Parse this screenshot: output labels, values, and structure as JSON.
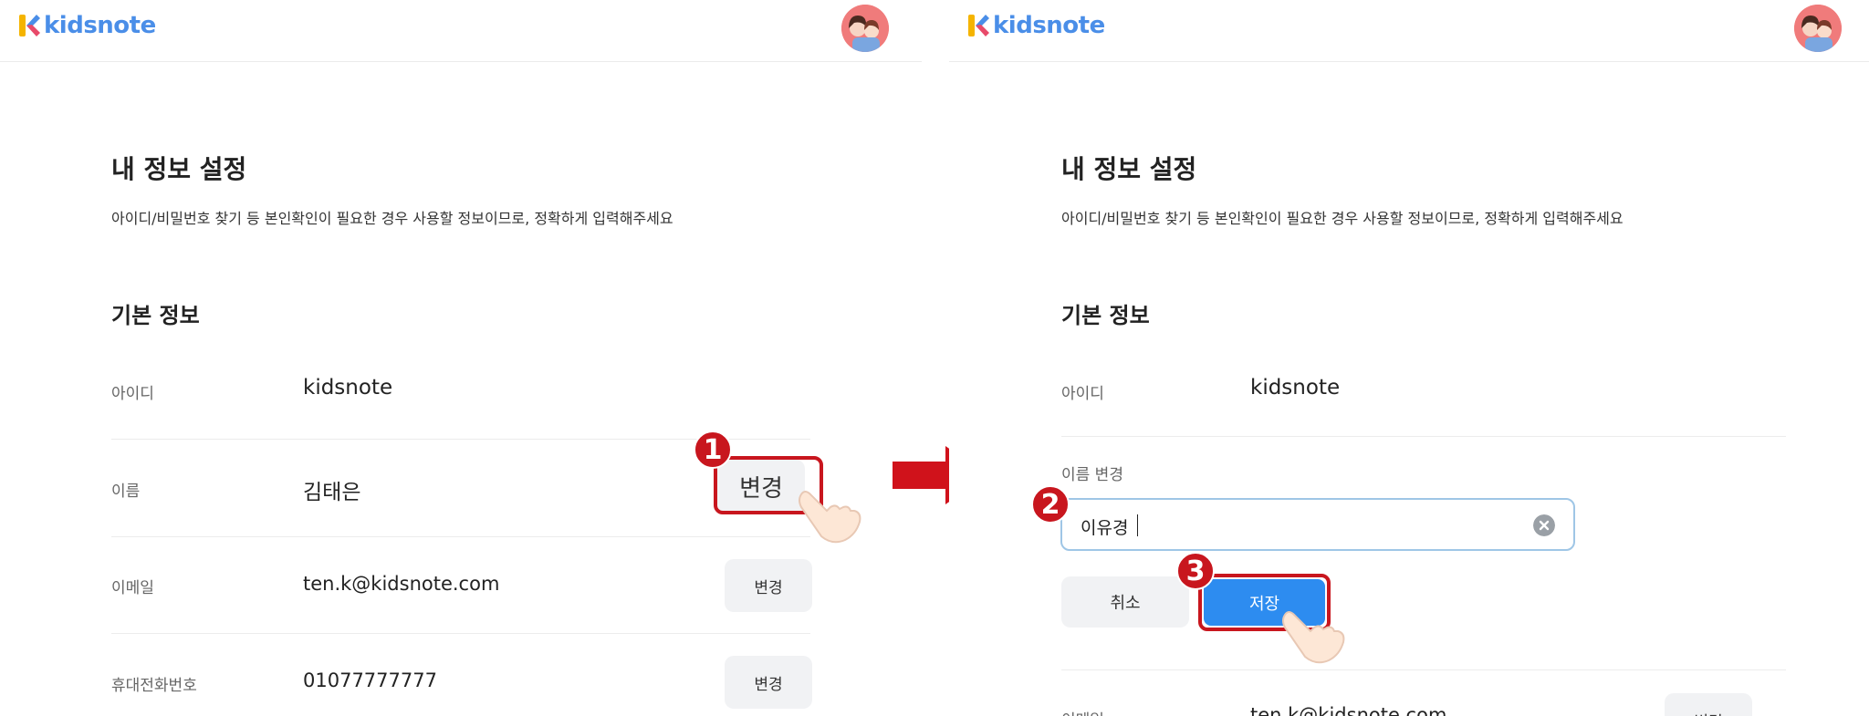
{
  "brand": {
    "name": "kidsnote"
  },
  "header": {
    "title": "내 정보 설정",
    "description": "아이디/비밀번호 찾기 등 본인확인이 필요한 경우 사용할 정보이므로, 정확하게 입력해주세요"
  },
  "section": {
    "title": "기본 정보"
  },
  "left": {
    "rows": [
      {
        "label": "아이디",
        "value": "kidsnote"
      },
      {
        "label": "이름",
        "value": "김태은",
        "button": "변경"
      },
      {
        "label": "이메일",
        "value": "ten.k@kidsnote.com",
        "button": "변경"
      },
      {
        "label": "휴대전화번호",
        "value": "01077777777",
        "button": "변경"
      }
    ]
  },
  "right": {
    "rows": [
      {
        "label": "아이디",
        "value": "kidsnote"
      }
    ],
    "name_edit": {
      "label": "이름 변경",
      "value": "이유경",
      "cancel": "취소",
      "save": "저장"
    },
    "email_row": {
      "label": "이메일",
      "value": "ten.k@kidsnote.com",
      "button": "변경"
    }
  },
  "steps": [
    "1",
    "2",
    "3"
  ],
  "colors": {
    "brand": "#4a8ee8",
    "highlight": "#c8161e",
    "save": "#2d8cf0",
    "arrow": "#d0121b"
  },
  "icons": [
    "kidsnote-logo-icon",
    "avatar-icon",
    "pointer-hand-icon",
    "clear-input-icon",
    "right-arrow-icon"
  ]
}
